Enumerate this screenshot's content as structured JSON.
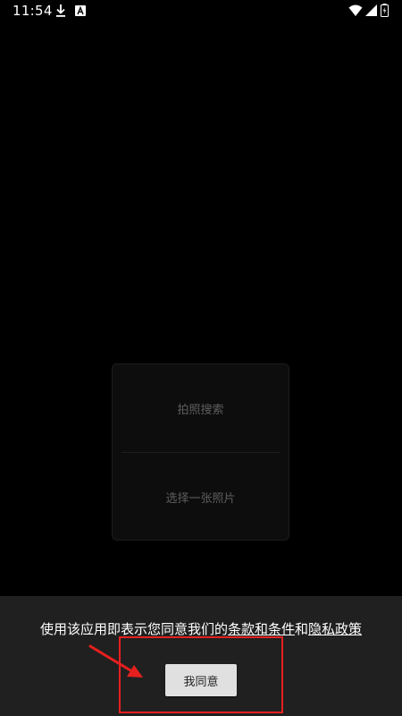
{
  "status_bar": {
    "time": "11:54",
    "left_icons": [
      "download-icon",
      "a-icon"
    ],
    "right_icons": [
      "wifi-icon",
      "signal-icon",
      "battery-icon"
    ]
  },
  "menu": {
    "items": [
      {
        "label": "拍照搜索"
      },
      {
        "label": "选择一张照片"
      }
    ]
  },
  "consent": {
    "text_prefix": "使用该应用即表示您同意我们的",
    "terms_link": "条款和条件",
    "conjunction": "和",
    "privacy_link": "隐私政策",
    "agree_button": "我同意"
  },
  "colors": {
    "background": "#000000",
    "panel": "#202020",
    "button": "#e0e0e0",
    "annotation": "#e5201e"
  }
}
